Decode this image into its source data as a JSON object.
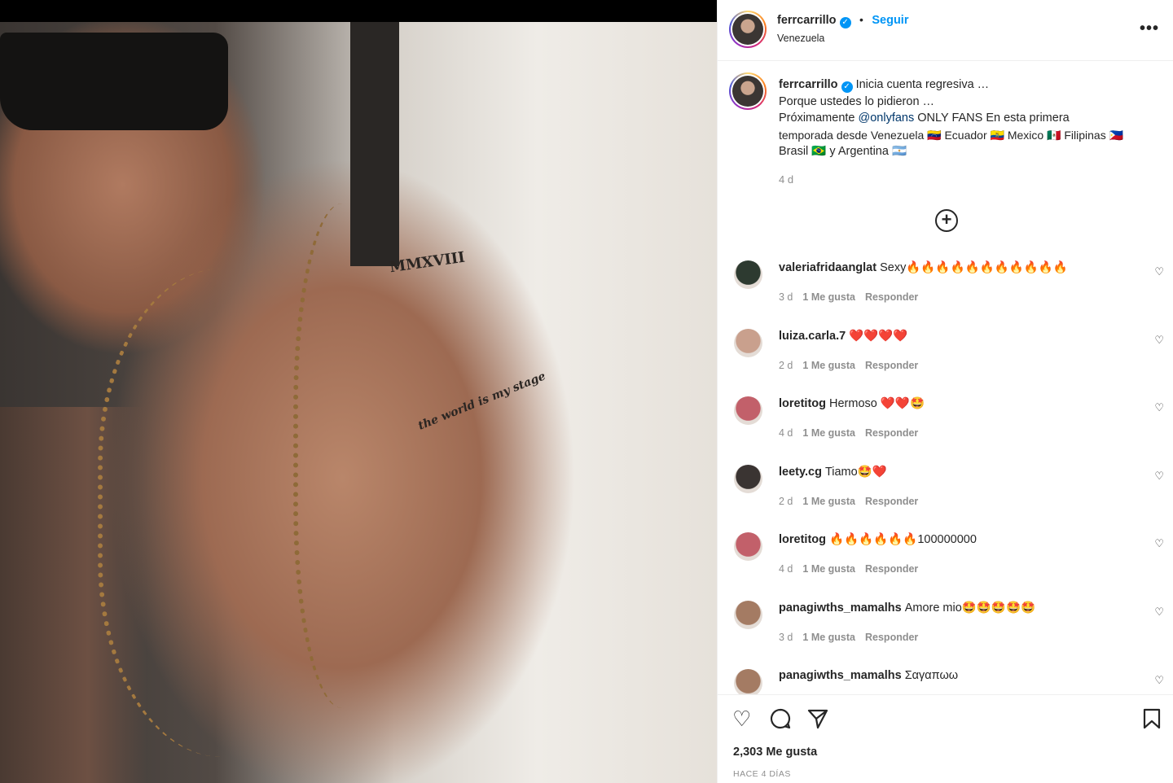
{
  "post": {
    "username": "ferrcarrillo",
    "follow_label": "Seguir",
    "separator": "•",
    "location": "Venezuela",
    "more_icon": "more-horizontal-icon"
  },
  "caption": {
    "username": "ferrcarrillo",
    "lines": [
      "Inicia cuenta regresiva …",
      "Porque ustedes lo pidieron …",
      "Próximamente",
      "@onlyfans",
      "ONLY FANS En esta primera",
      "temporada desde Venezuela 🇻🇪 Ecuador 🇪🇨 Mexico 🇲🇽 Filipinas 🇵🇭",
      "Brasil 🇧🇷 y Argentina 🇦🇷"
    ],
    "time": "4 d"
  },
  "comments": [
    {
      "username": "valeriafridaanglat",
      "text": "Sexy🔥🔥🔥🔥🔥🔥🔥🔥🔥🔥🔥",
      "time": "3 d",
      "likes": "1 Me gusta",
      "reply": "Responder",
      "avatar_color": "#2d3a30"
    },
    {
      "username": "luiza.carla.7",
      "text": "❤️❤️❤️❤️",
      "time": "2 d",
      "likes": "1 Me gusta",
      "reply": "Responder",
      "avatar_color": "#c9a08d"
    },
    {
      "username": "loretitog",
      "text": "Hermoso ❤️❤️🤩",
      "time": "4 d",
      "likes": "1 Me gusta",
      "reply": "Responder",
      "avatar_color": "#c2606a"
    },
    {
      "username": "leety.cg",
      "text": "Tiamo🤩❤️",
      "time": "2 d",
      "likes": "1 Me gusta",
      "reply": "Responder",
      "avatar_color": "#3a3432"
    },
    {
      "username": "loretitog",
      "text": "🔥🔥🔥🔥🔥🔥100000000",
      "time": "4 d",
      "likes": "1 Me gusta",
      "reply": "Responder",
      "avatar_color": "#c2606a"
    },
    {
      "username": "panagiwths_mamalhs",
      "text": "Amore mio🤩🤩🤩🤩🤩",
      "time": "3 d",
      "likes": "1 Me gusta",
      "reply": "Responder",
      "avatar_color": "#a47b63"
    },
    {
      "username": "panagiwths_mamalhs",
      "text": "Σαγαπωω",
      "time": "",
      "likes": "",
      "reply": "",
      "avatar_color": "#a47b63"
    }
  ],
  "actions": {
    "likes": "2,303 Me gusta",
    "ago": "HACE 4 DÍAS"
  },
  "photo_tattoo": {
    "roman": "MMXVIII",
    "script": "the world is my stage"
  }
}
